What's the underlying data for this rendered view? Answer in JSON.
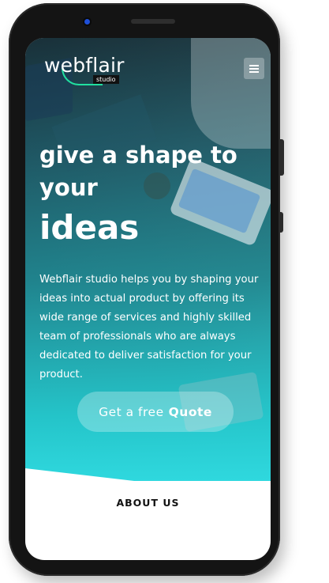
{
  "header": {
    "logo_text": "webflair",
    "logo_sub": "studio",
    "menu_icon": "hamburger-menu-icon"
  },
  "hero": {
    "headline_line1": "give a shape to",
    "headline_line2": "your",
    "headline_line3": "ideas",
    "description": "Webflair studio helps you by shaping your ideas into actual product by offering its wide range of services and highly skilled team of professionals who are always dedicated to deliver satisfaction for your product.",
    "cta_prefix": "Get a free",
    "cta_bold": "Quote"
  },
  "sections": {
    "about_label": "ABOUT US"
  },
  "colors": {
    "accent": "#2fd8de",
    "logo_swoosh": "#21e0a0",
    "phone_frame": "#141414"
  }
}
